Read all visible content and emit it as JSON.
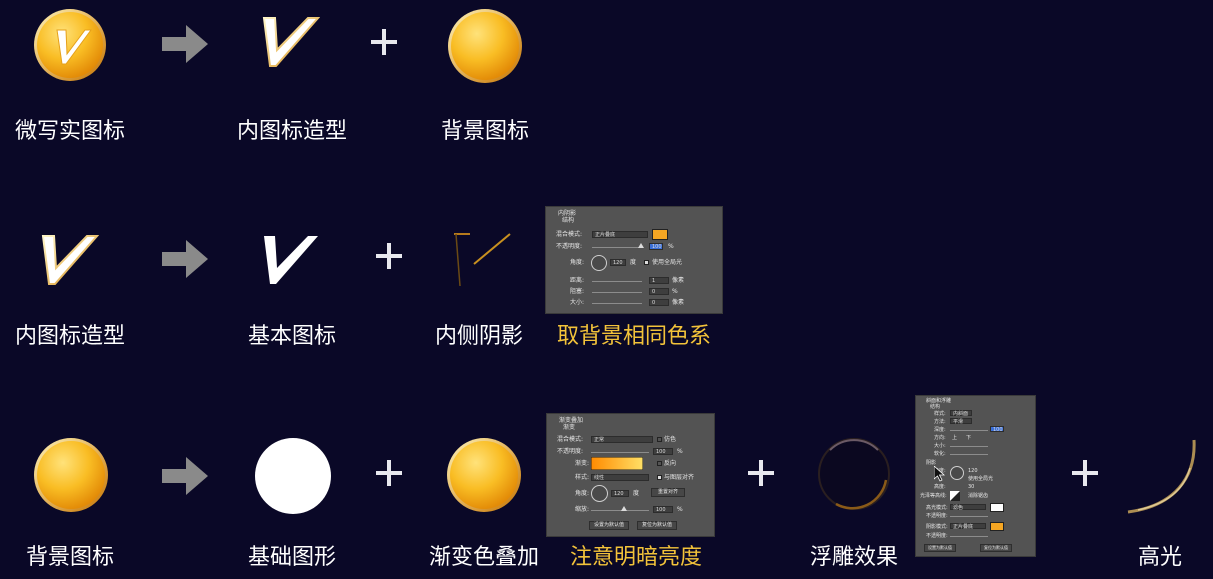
{
  "rows": [
    {
      "labels": [
        "微写实图标",
        "内图标造型",
        "背景图标"
      ],
      "operators": [
        "arrow",
        "plus"
      ],
      "highlighted_label": ""
    },
    {
      "labels": [
        "内图标造型",
        "基本图标",
        "内侧阴影"
      ],
      "operators": [
        "arrow",
        "plus"
      ],
      "highlighted_label": "取背景相同色系"
    },
    {
      "labels": [
        "背景图标",
        "基础图形",
        "渐变色叠加",
        "浮雕效果",
        "高光"
      ],
      "operators": [
        "arrow",
        "plus",
        "plus",
        "plus"
      ],
      "highlighted_label": "注意明暗亮度"
    }
  ],
  "colors": {
    "background": "#0a0827",
    "highlight_text": "#f3c33a",
    "coin_gold": "#f7b81c",
    "arrow_gray": "#8a8a8a",
    "panel_gray": "#535353",
    "accent_orange": "#f5a623"
  },
  "inner_shadow_panel": {
    "title": "内阴影",
    "section": "结构",
    "blend_mode_label": "混合模式:",
    "blend_mode_value": "正片叠底",
    "opacity_label": "不透明度:",
    "opacity_value": "100",
    "opacity_unit": "%",
    "angle_label": "角度:",
    "angle_value": "120",
    "angle_unit": "度",
    "global_light_label": "使用全局光",
    "distance_label": "距离:",
    "distance_value": "1",
    "distance_unit": "像素",
    "choke_label": "阻塞:",
    "choke_value": "0",
    "choke_unit": "%",
    "size_label": "大小:",
    "size_value": "0",
    "size_unit": "像素"
  },
  "gradient_panel": {
    "title": "渐变叠加",
    "section": "渐变",
    "blend_mode_label": "混合模式:",
    "blend_mode_value": "正常",
    "dither_label": "仿色",
    "opacity_label": "不透明度:",
    "opacity_value": "100",
    "opacity_unit": "%",
    "gradient_label": "渐变:",
    "reverse_label": "反向",
    "style_label": "样式:",
    "style_value": "线性",
    "align_label": "与图层对齐",
    "angle_label": "角度:",
    "angle_value": "120",
    "angle_unit": "度",
    "reset_align_label": "重置对齐",
    "scale_label": "缩放:",
    "scale_value": "100",
    "scale_unit": "%",
    "make_default_label": "设置为默认值",
    "reset_default_label": "复位为默认值"
  },
  "bevel_panel": {
    "title": "斜面和浮雕",
    "section": "结构",
    "style_label": "样式:",
    "style_value": "内斜面",
    "technique_label": "方法:",
    "technique_value": "平滑",
    "depth_label": "深度:",
    "depth_value": "100",
    "direction_label": "方向:",
    "direction_up": "上",
    "direction_down": "下",
    "size_label": "大小:",
    "soften_label": "软化:",
    "shading_section": "阴影",
    "angle_label": "角度:",
    "angle_value": "120",
    "global_light_label": "使用全局光",
    "altitude_label": "高度:",
    "altitude_value": "30",
    "gloss_label": "光泽等高线:",
    "antialias_label": "消除锯齿",
    "highlight_mode_label": "高光模式:",
    "highlight_mode_value": "滤色",
    "highlight_opacity_label": "不透明度:",
    "shadow_mode_label": "阴影模式:",
    "shadow_mode_value": "正片叠底",
    "shadow_opacity_label": "不透明度:",
    "make_default_label": "设置为默认值",
    "reset_default_label": "复位为默认值"
  }
}
